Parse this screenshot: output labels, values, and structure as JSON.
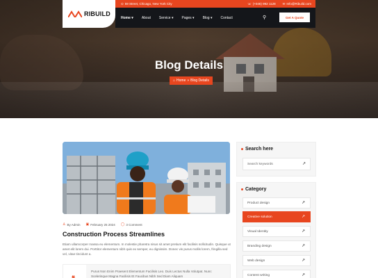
{
  "header": {
    "logo_text": "RIBUILD",
    "address": "59 Street, Chicago, New York City",
    "phone": "(+046) 992 1128",
    "email": "Info@Ribuild.com",
    "nav": [
      "Home",
      "About",
      "Service",
      "Pages",
      "Blog",
      "Contact"
    ],
    "quote_label": "Get A Quote"
  },
  "hero": {
    "title": "Blog Details",
    "breadcrumb_home": "Home",
    "breadcrumb_current": "Blog Details"
  },
  "post": {
    "author": "By Admin",
    "date": "February 25 2024",
    "comments": "3 Comment",
    "title": "Construction Process Streamlines",
    "excerpt": "Etiam ullamcorper massa eu elementum. In molestie pharetra nisus sit amet pretium elit facilisis sollicitudin. Quisque ut amet elit lorem dui. Porttitor elementum nibh quis ex semper, eu dignissim. Donec vis purus mollis lorem, fringilla sed vel, vitae tincidunt a.",
    "quote": "Purus Non Enim Praesent Elementum Facilisis Leo. Duis Lectus Nulla Volutpat. Nunc Scelerisque Magna Facilisis Et Faucibus Nibh Sed Diam Aliquam"
  },
  "sidebar": {
    "search_title": "Search here",
    "search_placeholder": "Search keywords",
    "category_title": "Category",
    "categories": [
      "Product design",
      "Creative solution",
      "Visual Identity",
      "Branding design",
      "Web design",
      "Content writing"
    ]
  },
  "colors": {
    "accent": "#e8461f",
    "dark": "#14161a"
  }
}
